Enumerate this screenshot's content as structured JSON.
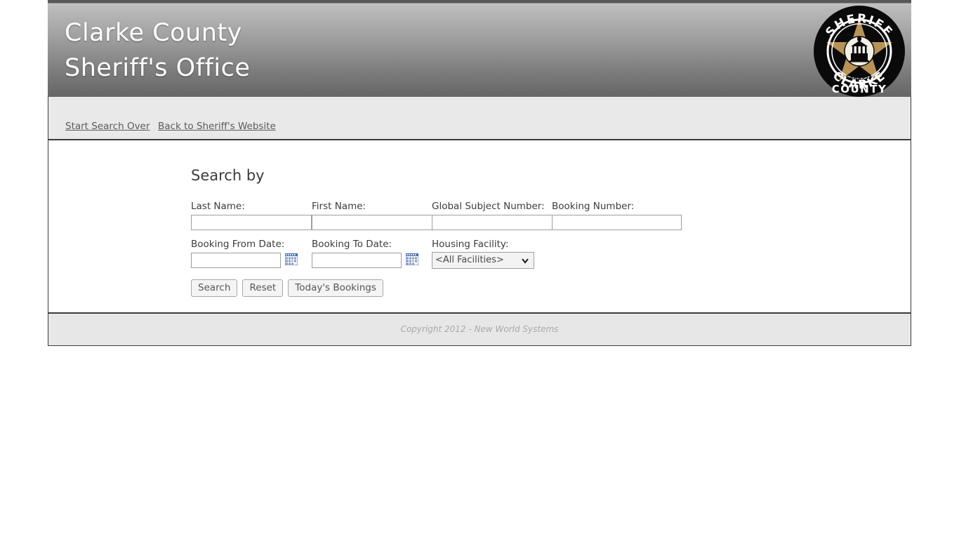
{
  "header": {
    "title_line1": "Clarke County",
    "title_line2": "Sheriff's Office",
    "badge": {
      "icon": "sheriff-badge-icon",
      "top_text": "SHERIFF",
      "mid_text": "GEORGIA",
      "bottom_text_1": "CLARKE",
      "bottom_text_2": "COUNTY",
      "star_color": "#b99356",
      "disc_color": "#0a0a0a"
    }
  },
  "nav": {
    "links": [
      {
        "label": "Start Search Over",
        "name": "start-search-over-link"
      },
      {
        "label": "Back to Sheriff's Website",
        "name": "back-to-sheriffs-website-link"
      }
    ]
  },
  "main": {
    "heading": "Search by",
    "fields": {
      "last_name": {
        "label": "Last Name:",
        "value": "",
        "placeholder": ""
      },
      "first_name": {
        "label": "First Name:",
        "value": "",
        "placeholder": ""
      },
      "global_subject_number": {
        "label": "Global Subject Number:",
        "value": "",
        "placeholder": ""
      },
      "booking_number": {
        "label": "Booking Number:",
        "value": "",
        "placeholder": ""
      },
      "booking_from_date": {
        "label": "Booking From Date:",
        "value": "",
        "placeholder": "",
        "icon": "calendar-icon"
      },
      "booking_to_date": {
        "label": "Booking To Date:",
        "value": "",
        "placeholder": "",
        "icon": "calendar-icon"
      },
      "housing_facility": {
        "label": "Housing Facility:",
        "selected": "<All Facilities>",
        "icon": "chevron-down-icon"
      }
    },
    "buttons": {
      "search": "Search",
      "reset": "Reset",
      "todays_bookings": "Today's Bookings"
    }
  },
  "footer": {
    "text": "Copyright 2012 - New World Systems"
  }
}
